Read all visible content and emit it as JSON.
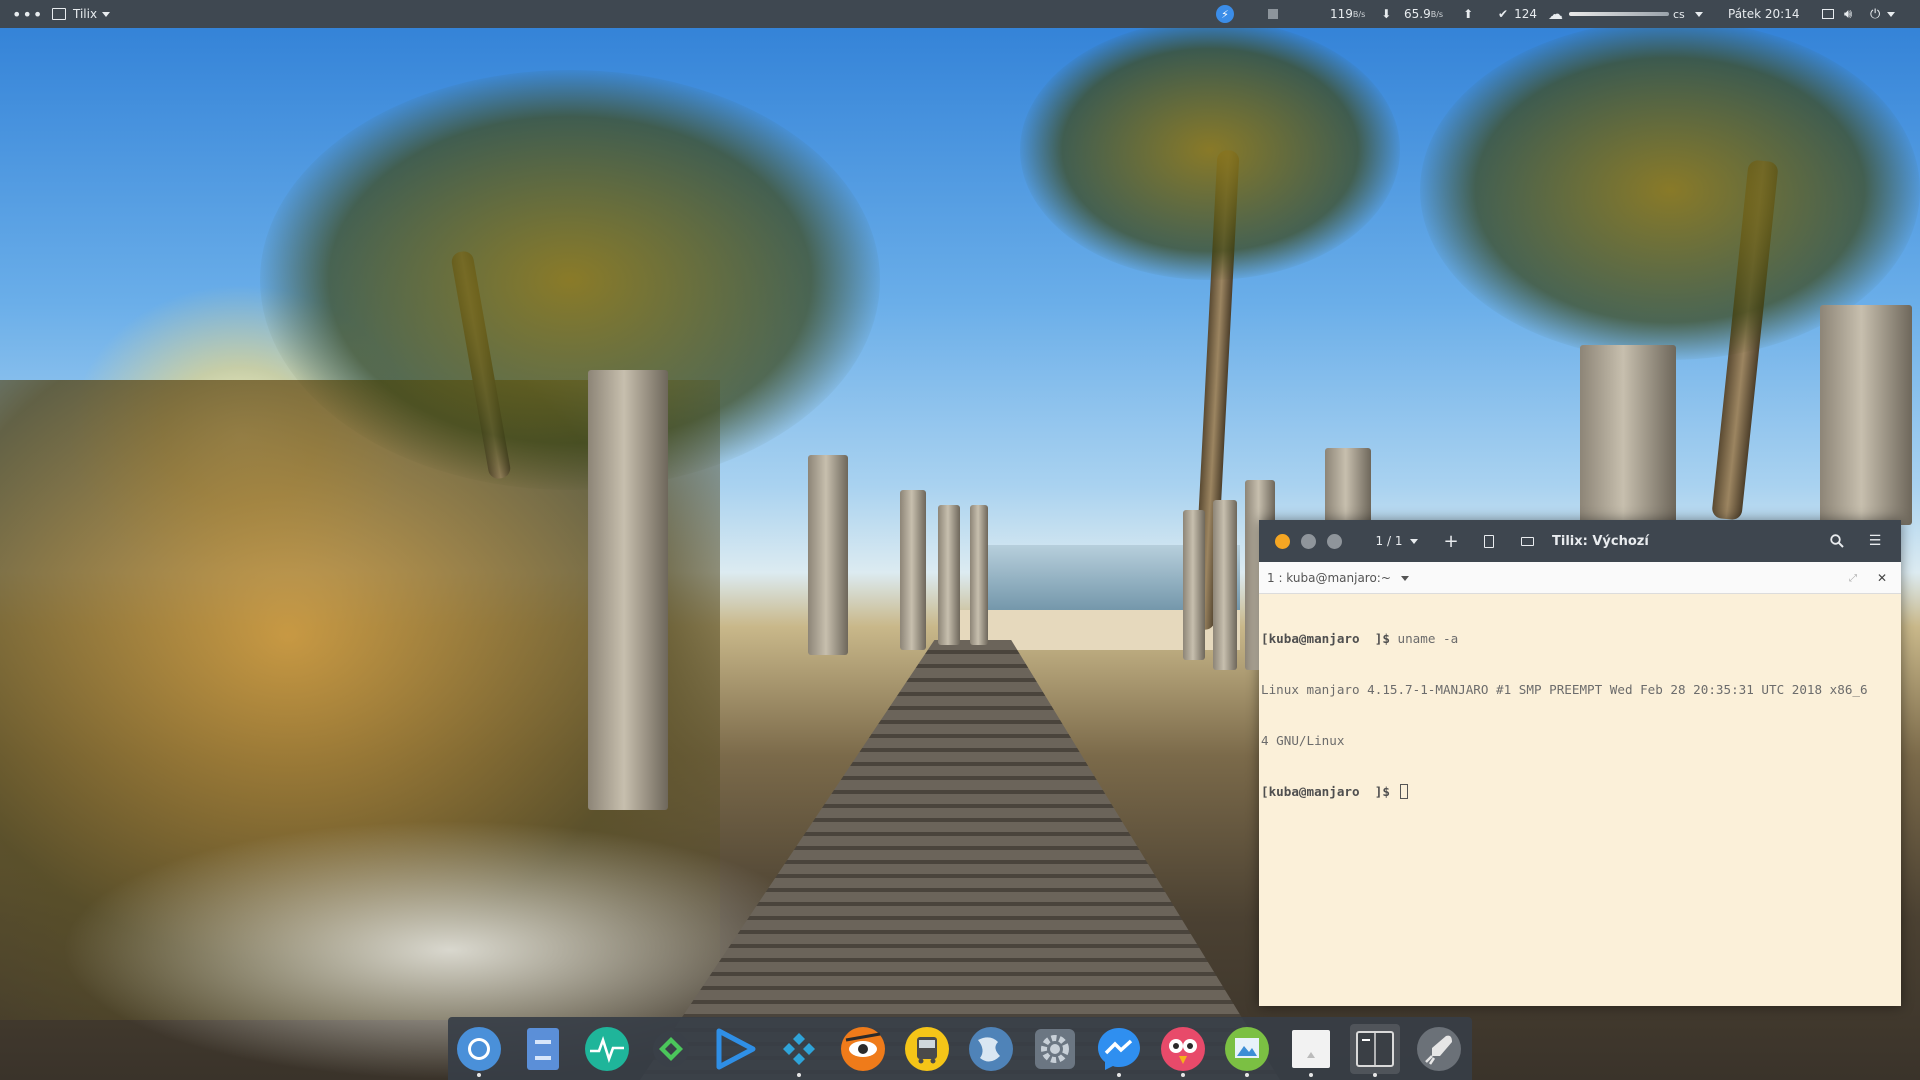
{
  "top_panel": {
    "menu_icon": "more-horizontal-icon",
    "app_name": "Tilix",
    "messenger_indicator": "messenger-icon",
    "upload_speed": "119",
    "upload_unit": "B/s",
    "download_speed": "65.9",
    "download_unit": "B/s",
    "updates_count": "124",
    "keyboard_layout": "cs",
    "clock": "Pátek 20:14"
  },
  "terminal": {
    "session_counter": "1 / 1",
    "title": "Tilix: Výchozí",
    "tab_label": "1 : kuba@manjaro:~",
    "lines": [
      {
        "prompt": "[kuba@manjaro  ]$",
        "text": " uname -a"
      },
      {
        "prompt": "",
        "text": "Linux manjaro 4.15.7-1-MANJARO #1 SMP PREEMPT Wed Feb 28 20:35:31 UTC 2018 x86_6"
      },
      {
        "prompt": "",
        "text": "4 GNU/Linux"
      },
      {
        "prompt": "[kuba@manjaro  ]$",
        "text": " "
      }
    ],
    "colors": {
      "close": "#f5a623",
      "inactive": "#9aa0a6"
    }
  },
  "dock": {
    "items": [
      {
        "name": "chromium-icon"
      },
      {
        "name": "file-manager-icon"
      },
      {
        "name": "system-monitor-icon"
      },
      {
        "name": "anydesk-icon"
      },
      {
        "name": "media-player-icon"
      },
      {
        "name": "kodi-icon"
      },
      {
        "name": "eye-of-tiger-icon"
      },
      {
        "name": "bus-icon"
      },
      {
        "name": "web-browser-icon"
      },
      {
        "name": "settings-icon"
      },
      {
        "name": "messenger-icon"
      },
      {
        "name": "parrot-icon"
      },
      {
        "name": "image-viewer-icon"
      },
      {
        "name": "blank-app-icon"
      },
      {
        "name": "terminal-icon"
      },
      {
        "name": "launcher-icon"
      }
    ]
  }
}
